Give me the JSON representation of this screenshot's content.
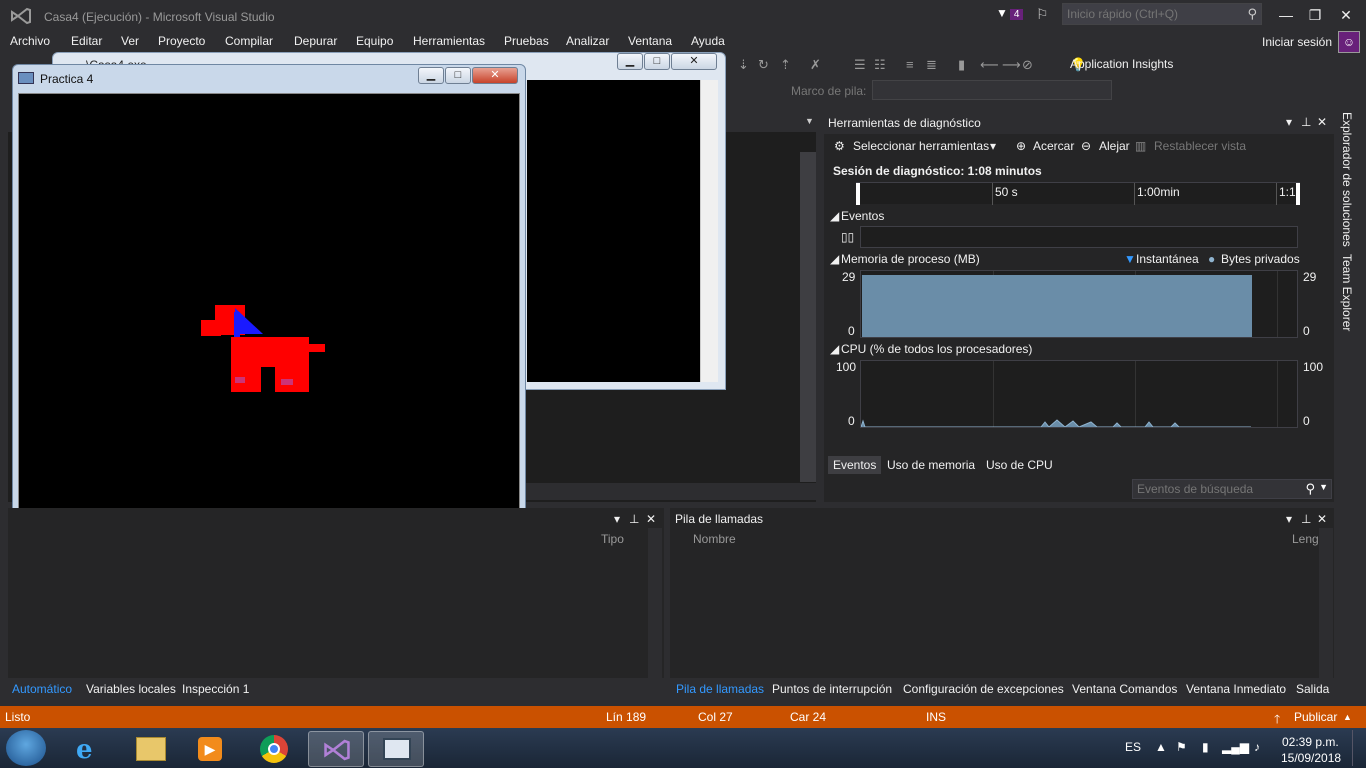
{
  "titlebar": {
    "title": "Casa4 (Ejecución) - Microsoft Visual Studio",
    "notifications_count": "4",
    "quick_launch_placeholder": "Inicio rápido (Ctrl+Q)"
  },
  "menu": {
    "items": [
      "Archivo",
      "Editar",
      "Ver",
      "Proyecto",
      "Compilar",
      "Depurar",
      "Equipo",
      "Herramientas",
      "Pruebas",
      "Analizar",
      "Ventana",
      "Ayuda"
    ],
    "signin": "Iniciar sesión"
  },
  "toolbar": {
    "app_insights": "Application Insights",
    "stack_frame_label": "Marco de pila:"
  },
  "console_window": {
    "title": "...\\Casa4.exe"
  },
  "practica_window": {
    "title": "Practica 4"
  },
  "diagnostics": {
    "title": "Herramientas de diagnóstico",
    "select_tools": "Seleccionar herramientas",
    "zoom_in": "Acercar",
    "zoom_out": "Alejar",
    "reset_view": "Restablecer vista",
    "session": "Sesión de diagnóstico: 1:08 minutos",
    "timeline_labels": [
      "50 s",
      "1:00min",
      "1:1"
    ],
    "events_label": "Eventos",
    "memory_label": "Memoria de proceso (MB)",
    "snapshot_legend": "Instantánea",
    "private_bytes_legend": "Bytes privados",
    "memory_max": "29",
    "memory_min": "0",
    "cpu_label": "CPU (% de todos los procesadores)",
    "cpu_max": "100",
    "cpu_min": "0",
    "tabs": [
      "Eventos",
      "Uso de memoria",
      "Uso de CPU"
    ],
    "event_search_placeholder": "Eventos de búsqueda"
  },
  "sidebar_tabs": [
    "Explorador de soluciones",
    "Team Explorer"
  ],
  "autos_panel": {
    "col_tipo": "Tipo",
    "tabs": [
      "Automático",
      "Variables locales",
      "Inspección 1"
    ]
  },
  "callstack_panel": {
    "title": "Pila de llamadas",
    "col_name": "Nombre",
    "col_lang": "Leng",
    "tabs": [
      "Pila de llamadas",
      "Puntos de interrupción",
      "Configuración de excepciones",
      "Ventana Comandos",
      "Ventana Inmediato",
      "Salida"
    ]
  },
  "statusbar": {
    "ready": "Listo",
    "line": "Lín 189",
    "col": "Col 27",
    "car": "Car 24",
    "ins": "INS",
    "publish": "Publicar"
  },
  "taskbar": {
    "lang": "ES",
    "time": "02:39 p.m.",
    "date": "15/09/2018"
  },
  "colors": {
    "vs_bg": "#2d2d30",
    "status_orange": "#ca5100",
    "accent_purple": "#68217a",
    "dog_red": "#ff0000",
    "dog_blue": "#1a1aff"
  }
}
